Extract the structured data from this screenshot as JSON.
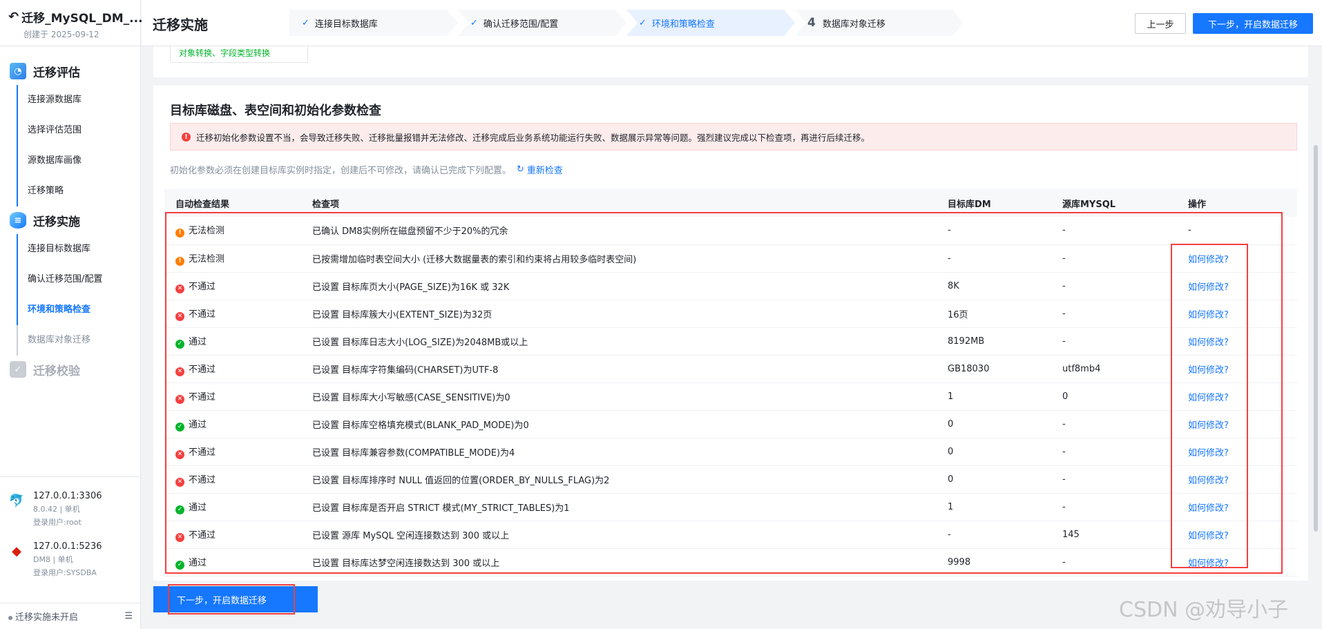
{
  "sidebar": {
    "title": "迁移_MySQL_DM_...",
    "created": "创建于 2025-09-12",
    "groups": [
      {
        "label": "迁移评估",
        "items": [
          "连接源数据库",
          "选择评估范围",
          "源数据库画像",
          "迁移策略"
        ]
      },
      {
        "label": "迁移实施",
        "items": [
          "连接目标数据库",
          "确认迁移范围/配置",
          "环境和策略检查",
          "数据库对象迁移"
        ]
      },
      {
        "label": "迁移校验",
        "items": []
      }
    ],
    "connections": [
      {
        "host": "127.0.0.1:3306",
        "meta": "8.0.42 | 单机",
        "user": "登录用户:root"
      },
      {
        "host": "127.0.0.1:5236",
        "meta": "DM8 | 单机",
        "user": "登录用户:SYSDBA"
      }
    ],
    "footer_status": "迁移实施未开启",
    "footer_icon": "collapse-icon"
  },
  "header": {
    "title": "迁移实施",
    "steps": [
      {
        "mark": "✓",
        "label": "连接目标数据库"
      },
      {
        "mark": "✓",
        "label": "确认迁移范围/配置"
      },
      {
        "mark": "✓",
        "label": "环境和策略检查"
      },
      {
        "mark": "4",
        "label": "数据库对象迁移"
      }
    ],
    "prev_button": "上一步",
    "next_button": "下一步，开启数据迁移"
  },
  "top_tag": "对象转换、字段类型转换",
  "check": {
    "title": "目标库磁盘、表空间和初始化参数检查",
    "alert": "迁移初始化参数设置不当，会导致迁移失败、迁移批量报错并无法修改、迁移完成后业务系统功能运行失败、数据展示异常等问题。强烈建议完成以下检查项，再进行后续迁移。",
    "note": "初始化参数必须在创建目标库实例时指定，创建后不可修改，请确认已完成下列配置。",
    "recheck": "重新检查",
    "columns": [
      "自动检查结果",
      "检查项",
      "目标库DM",
      "源库MYSQL",
      "操作"
    ],
    "rows": [
      {
        "status": "warn",
        "result": "无法检测",
        "item": "已确认 DM8实例所在磁盘预留不少于20%的冗余",
        "dm": "-",
        "mysql": "-",
        "action": "-"
      },
      {
        "status": "warn",
        "result": "无法检测",
        "item": "已按需增加临时表空间大小 (迁移大数据量表的索引和约束将占用较多临时表空间)",
        "dm": "-",
        "mysql": "-",
        "action": "如何修改?"
      },
      {
        "status": "fail",
        "result": "不通过",
        "item": "已设置 目标库页大小(PAGE_SIZE)为16K 或 32K",
        "dm": "8K",
        "mysql": "-",
        "action": "如何修改?"
      },
      {
        "status": "fail",
        "result": "不通过",
        "item": "已设置 目标库簇大小(EXTENT_SIZE)为32页",
        "dm": "16页",
        "mysql": "-",
        "action": "如何修改?"
      },
      {
        "status": "pass",
        "result": "通过",
        "item": "已设置 目标库日志大小(LOG_SIZE)为2048MB或以上",
        "dm": "8192MB",
        "mysql": "-",
        "action": "如何修改?"
      },
      {
        "status": "fail",
        "result": "不通过",
        "item": "已设置 目标库字符集编码(CHARSET)为UTF-8",
        "dm": "GB18030",
        "mysql": "utf8mb4",
        "action": "如何修改?"
      },
      {
        "status": "fail",
        "result": "不通过",
        "item": "已设置 目标库大小写敏感(CASE_SENSITIVE)为0",
        "dm": "1",
        "mysql": "0",
        "action": "如何修改?"
      },
      {
        "status": "pass",
        "result": "通过",
        "item": "已设置 目标库空格填充模式(BLANK_PAD_MODE)为0",
        "dm": "0",
        "mysql": "-",
        "action": "如何修改?"
      },
      {
        "status": "fail",
        "result": "不通过",
        "item": "已设置 目标库兼容参数(COMPATIBLE_MODE)为4",
        "dm": "0",
        "mysql": "-",
        "action": "如何修改?"
      },
      {
        "status": "fail",
        "result": "不通过",
        "item": "已设置 目标库排序时 NULL 值返回的位置(ORDER_BY_NULLS_FLAG)为2",
        "dm": "0",
        "mysql": "-",
        "action": "如何修改?"
      },
      {
        "status": "pass",
        "result": "通过",
        "item": "已设置 目标库是否开启 STRICT 模式(MY_STRICT_TABLES)为1",
        "dm": "1",
        "mysql": "-",
        "action": "如何修改?"
      },
      {
        "status": "fail",
        "result": "不通过",
        "item": "已设置 源库 MySQL 空闲连接数达到 300 或以上",
        "dm": "-",
        "mysql": "145",
        "action": "如何修改?"
      },
      {
        "status": "pass",
        "result": "通过",
        "item": "已设置 目标库达梦空闲连接数达到 300 或以上",
        "dm": "9998",
        "mysql": "-",
        "action": "如何修改?"
      }
    ]
  },
  "bottom_button": "下一步，开启数据迁移",
  "watermark": "CSDN @劝导小子",
  "colors": {
    "primary": "#1677ff",
    "fail": "#f53f3f",
    "pass": "#00b42a",
    "warn": "#ff7d00"
  }
}
